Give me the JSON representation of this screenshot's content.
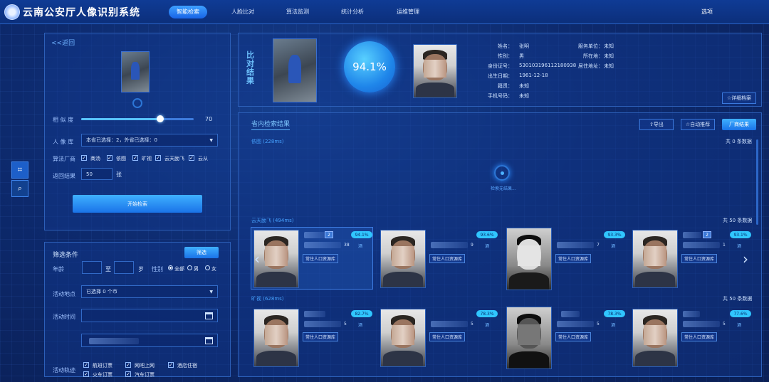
{
  "header": {
    "title": "云南公安厅人像识别系统",
    "nav": [
      "智能检索",
      "人脸比对",
      "算法监测",
      "统计分析",
      "运维管理"
    ],
    "options": "选项"
  },
  "search": {
    "back": "<<返回",
    "similarity_label": "相 似 度",
    "similarity_value": "70",
    "similarity_level": 0.7,
    "library_label": "人 像 库",
    "library_value": "本省已选择：2，外省已选择：0",
    "vendor_label": "算法厂商",
    "vendors": [
      "商汤",
      "依图",
      "旷视",
      "云天励飞",
      "云从"
    ],
    "result_label": "返回结果",
    "result_value": "50",
    "result_unit": "张",
    "start_button": "开始检索"
  },
  "filter": {
    "title": "筛选条件",
    "filter_button": "筛选",
    "age_label": "年龄",
    "age_to": "至",
    "age_unit": "岁",
    "gender_label": "性别",
    "gender_options": [
      "全部",
      "男",
      "女"
    ],
    "location_label": "活动地点",
    "location_value": "已选择 0 个市",
    "time_label": "活动时间",
    "trace_label": "活动轨迹",
    "traces": [
      "航班订票",
      "网吧上网",
      "酒店住宿",
      "火车订票",
      "汽车订票"
    ]
  },
  "compare": {
    "title": "比对结果",
    "score": "94.1%",
    "fields": [
      {
        "label": "姓名：",
        "value": "张明"
      },
      {
        "label": "性别：",
        "value": "男"
      },
      {
        "label": "身份证号：",
        "value": "530103196112180938"
      },
      {
        "label": "出生日期：",
        "value": "1961-12-18"
      },
      {
        "label": "籍贯：",
        "value": "未知"
      },
      {
        "label": "手机号码：",
        "value": "未知"
      }
    ],
    "fields_right": [
      {
        "label": "服务单位：",
        "value": "未知"
      },
      {
        "label": "所在地：",
        "value": "未知"
      },
      {
        "label": "居住地址：",
        "value": "未知"
      }
    ],
    "detail_button": "☆详细档案"
  },
  "results": {
    "tab": "省内检索结果",
    "export": "⇧导出",
    "auto_push": "☆自动推荐",
    "vendor_result": "厂商结果",
    "groups": [
      {
        "name": "依图 (228ms)",
        "count": "共 0 条数据",
        "empty": "检索无结果..."
      },
      {
        "name": "云天励飞 (494ms)",
        "count": "共 50 条数据"
      },
      {
        "name": "旷视 (628ms)",
        "count": "共 50 条数据"
      }
    ],
    "row1": [
      {
        "pct": "94.1%",
        "lib": "常住人口资源库",
        "badge": "2",
        "num": "38",
        "loc": "酒"
      },
      {
        "pct": "93.6%",
        "lib": "常住人口资源库",
        "num": "9",
        "loc": "酒"
      },
      {
        "pct": "93.3%",
        "lib": "常住人口资源库",
        "num": "7",
        "loc": "酒"
      },
      {
        "pct": "93.1%",
        "lib": "常住人口资源库",
        "badge": "2",
        "num": "1",
        "loc": "酒"
      }
    ],
    "row2": [
      {
        "pct": "82.7%",
        "lib": "常住人口资源库",
        "num": "5",
        "loc": "酒"
      },
      {
        "pct": "78.3%",
        "lib": "常住人口资源库",
        "num": "5",
        "loc": "酒"
      },
      {
        "pct": "78.3%",
        "lib": "常住人口资源库",
        "num": "5",
        "loc": "酒"
      },
      {
        "pct": "77.6%",
        "lib": "常住人口资源库",
        "num": "5",
        "loc": "酒"
      }
    ]
  }
}
